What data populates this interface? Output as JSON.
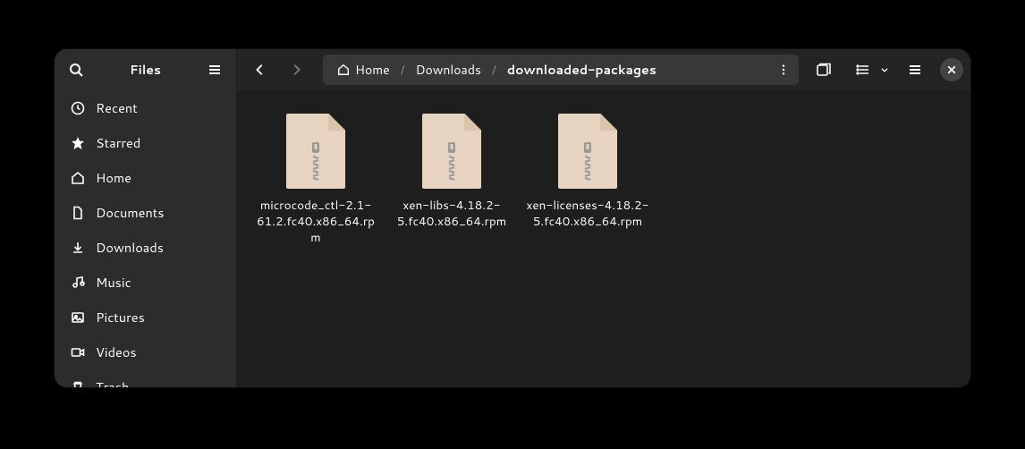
{
  "app": {
    "title": "Files"
  },
  "sidebar": {
    "items": [
      {
        "label": "Recent",
        "icon": "clock-icon"
      },
      {
        "label": "Starred",
        "icon": "star-icon"
      },
      {
        "label": "Home",
        "icon": "home-icon"
      },
      {
        "label": "Documents",
        "icon": "document-icon"
      },
      {
        "label": "Downloads",
        "icon": "download-icon"
      },
      {
        "label": "Music",
        "icon": "music-icon"
      },
      {
        "label": "Pictures",
        "icon": "picture-icon"
      },
      {
        "label": "Videos",
        "icon": "video-icon"
      },
      {
        "label": "Trash",
        "icon": "trash-icon"
      }
    ]
  },
  "breadcrumb": {
    "segments": [
      {
        "label": "Home",
        "has_icon": true
      },
      {
        "label": "Downloads"
      },
      {
        "label": "downloaded-packages",
        "current": true
      }
    ]
  },
  "files": [
    {
      "name": "microcode_ctl-2.1-61.2.fc40.x86_64.rpm",
      "type": "archive"
    },
    {
      "name": "xen-libs-4.18.2-5.fc40.x86_64.rpm",
      "type": "archive"
    },
    {
      "name": "xen-licenses-4.18.2-5.fc40.x86_64.rpm",
      "type": "archive"
    }
  ]
}
